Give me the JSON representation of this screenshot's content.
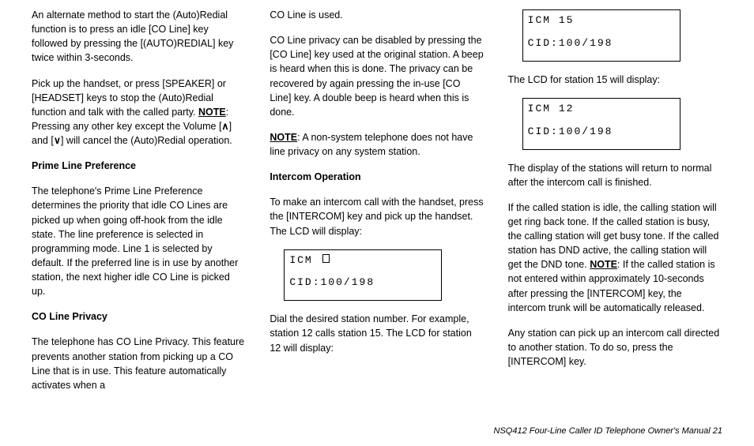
{
  "col1": {
    "p1a": "An alternate method to start the (Auto)Redial function is to press an idle [CO Line] key followed by pressing the [(AUTO)REDIAL] key twice within 3-seconds.",
    "p2a": "Pick up the handset, or press [SPEAKER] or [HEADSET] keys to stop the (Auto)Redial function and talk with the called party. ",
    "p2_note": "NOTE",
    "p2b": ": Pressing any other key except the Volume [",
    "p2c": "] and [",
    "p2d": "] will cancel the (Auto)Redial operation.",
    "arrow_up": "∧",
    "arrow_down": "∨",
    "h1": "Prime Line Preference",
    "p3": "The telephone's Prime Line Preference determines the priority that idle CO Lines are picked up when going off-hook from the idle state. The line preference is selected in programming mode. Line 1 is selected by default. If the preferred line is in use by another station, the next higher idle CO Line is picked up.",
    "h2": "CO Line Privacy",
    "p4": "The telephone has CO Line Privacy. This feature prevents another station from picking up a CO Line that is in use. This feature automatically activates when a"
  },
  "col2": {
    "p1": "CO Line is used.",
    "p2": "CO Line privacy can be disabled by pressing the [CO Line] key used at the original station. A beep is heard when this is done. The privacy can be recovered by again pressing the in-use [CO Line] key. A double beep is heard when this is done.",
    "p3_note": "NOTE",
    "p3": ": A non-system telephone does not have line privacy on any system station.",
    "h1": "Intercom Operation",
    "p4": "To make an intercom call with the handset, press the [INTERCOM] key and pick up the handset. The LCD will display:",
    "lcd1": {
      "line1": "ICM ",
      "line2": "CID:100/198"
    },
    "p5": "Dial the desired station number. For example, station 12 calls station 15. The LCD for station 12 will display:"
  },
  "col3": {
    "lcd1": {
      "line1": "ICM 15",
      "line2": "CID:100/198"
    },
    "p1": "The LCD for station 15 will display:",
    "lcd2": {
      "line1": "ICM 12",
      "line2": "CID:100/198"
    },
    "p2": "The display of the stations will return to normal after the intercom call is finished.",
    "p3a": "If the called station is idle, the calling station will get ring back tone. If the called station is busy, the calling station will get busy tone. If the called station has DND active, the calling station will get the DND tone. ",
    "p3_note": "NOTE",
    "p3b": ": If the called station is not entered within approximately 10-seconds after pressing the [INTERCOM] key, the intercom trunk will be automatically released.",
    "p4": "Any station can pick up an intercom call directed to another station.  To do so, press the [INTERCOM] key."
  },
  "footer": "NSQ412 Four-Line Caller ID Telephone Owner's Manual    21"
}
